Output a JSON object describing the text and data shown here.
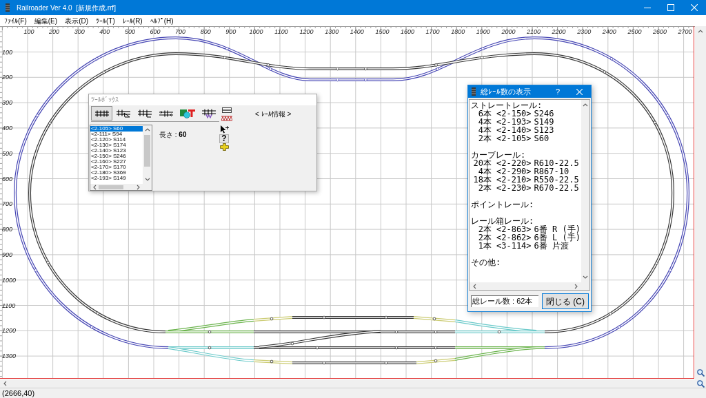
{
  "window": {
    "title": "Railroader Ver 4.0  [新規作成.rrf]"
  },
  "menu": [
    "ﾌｧｲﾙ(F)",
    "編集(E)",
    "表示(D)",
    "ﾂｰﾙ(T)",
    "ﾚｰﾙ(R)",
    "ﾍﾙﾌﾟ(H)"
  ],
  "ruler": {
    "x_labels": [
      "100",
      "200",
      "300",
      "400",
      "500",
      "600",
      "700",
      "800",
      "900",
      "1000",
      "1100",
      "1200",
      "1300",
      "1400",
      "1500",
      "1600",
      "1700",
      "1800",
      "1900",
      "2000",
      "2100",
      "2200",
      "2300",
      "2400",
      "2500",
      "2600",
      "2700"
    ],
    "y_labels": [
      "100",
      "200",
      "300",
      "400",
      "500",
      "600",
      "700",
      "800",
      "900",
      "1000",
      "1100",
      "1200",
      "1300"
    ]
  },
  "toolbox": {
    "title": "ﾂｰﾙﾎﾞｯｸｽ",
    "tools": [
      {
        "selected": true
      },
      {
        "selected": false
      },
      {
        "selected": false
      },
      {
        "selected": false
      },
      {
        "selected": false
      },
      {
        "selected": false
      }
    ],
    "info_label": "< ﾚｰﾙ情報 >",
    "rail_list": [
      {
        "label": "<2-105> S60",
        "selected": true
      },
      {
        "label": "<2-111> S94",
        "selected": false
      },
      {
        "label": "<2-120> S114",
        "selected": false
      },
      {
        "label": "<2-130> S174",
        "selected": false
      },
      {
        "label": "<2-140> S123",
        "selected": false
      },
      {
        "label": "<2-150> S246",
        "selected": false
      },
      {
        "label": "<2-160> S227",
        "selected": false
      },
      {
        "label": "<2-170> S170",
        "selected": false
      },
      {
        "label": "<2-180> S369",
        "selected": false
      },
      {
        "label": "<2-193> S149",
        "selected": false
      }
    ],
    "length": "長さ : **60**",
    "help_tool": "?"
  },
  "rail_count_dialog": {
    "title": "総ﾚｰﾙ数の表示",
    "help_button": "?",
    "sections": [
      {
        "heading": "ストレートレール:",
        "items": [
          {
            "count": "6本",
            "code": "<2-150>",
            "name": "S246"
          },
          {
            "count": "4本",
            "code": "<2-193>",
            "name": "S149"
          },
          {
            "count": "4本",
            "code": "<2-140>",
            "name": "S123"
          },
          {
            "count": "2本",
            "code": "<2-105>",
            "name": "S60"
          }
        ]
      },
      {
        "heading": "カーブレール:",
        "items": [
          {
            "count": "20本",
            "code": "<2-220>",
            "name": "R610-22.5"
          },
          {
            "count": "4本",
            "code": "<2-290>",
            "name": "R867-10"
          },
          {
            "count": "18本",
            "code": "<2-210>",
            "name": "R550-22.5"
          },
          {
            "count": "2本",
            "code": "<2-230>",
            "name": "R670-22.5"
          }
        ]
      },
      {
        "heading": "ポイントレール:"
      },
      {
        "heading": "レール箱レール:",
        "items": [
          {
            "count": "2本",
            "code": "<2-863>",
            "name": "6番 R (手)"
          },
          {
            "count": "2本",
            "code": "<2-862>",
            "name": "6番 L (手)"
          },
          {
            "count": "1本",
            "code": "<3-114>",
            "name": "6番 片渡"
          }
        ]
      },
      {
        "heading": "その他:"
      }
    ],
    "total": "総レール数 : 62本",
    "close_button": "閉じる (C)"
  },
  "status_bar": {
    "coordinates": "(2666,40)"
  }
}
